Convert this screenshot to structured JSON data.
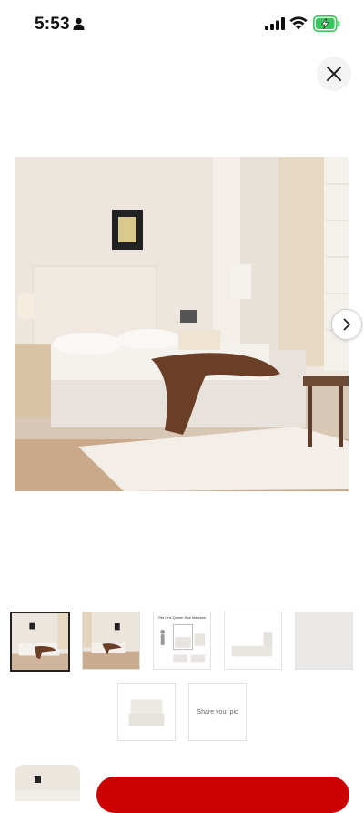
{
  "status_bar": {
    "time": "5:53",
    "icons": [
      "person-icon",
      "cellular-signal-icon",
      "wifi-icon",
      "battery-charging-icon"
    ],
    "battery_color": "#35c759"
  },
  "toolbar": {
    "close_icon": "close-icon"
  },
  "gallery": {
    "main_image": "bedroom-with-upholstered-storage-bed",
    "next_icon": "chevron-right-icon",
    "selected_index": 0,
    "thumbnails": [
      {
        "image": "bedroom-scene"
      },
      {
        "image": "bedroom-scene-wide"
      },
      {
        "image": "dimension-diagram",
        "caption": "Fits One Queen Size Mattress"
      },
      {
        "image": "bed-side-view"
      },
      {
        "image": "fabric-swatch"
      },
      {
        "image": "bed-front-view"
      }
    ],
    "share_label": "Share your pic"
  },
  "bottom_bar": {
    "accent": "#cc0000"
  }
}
